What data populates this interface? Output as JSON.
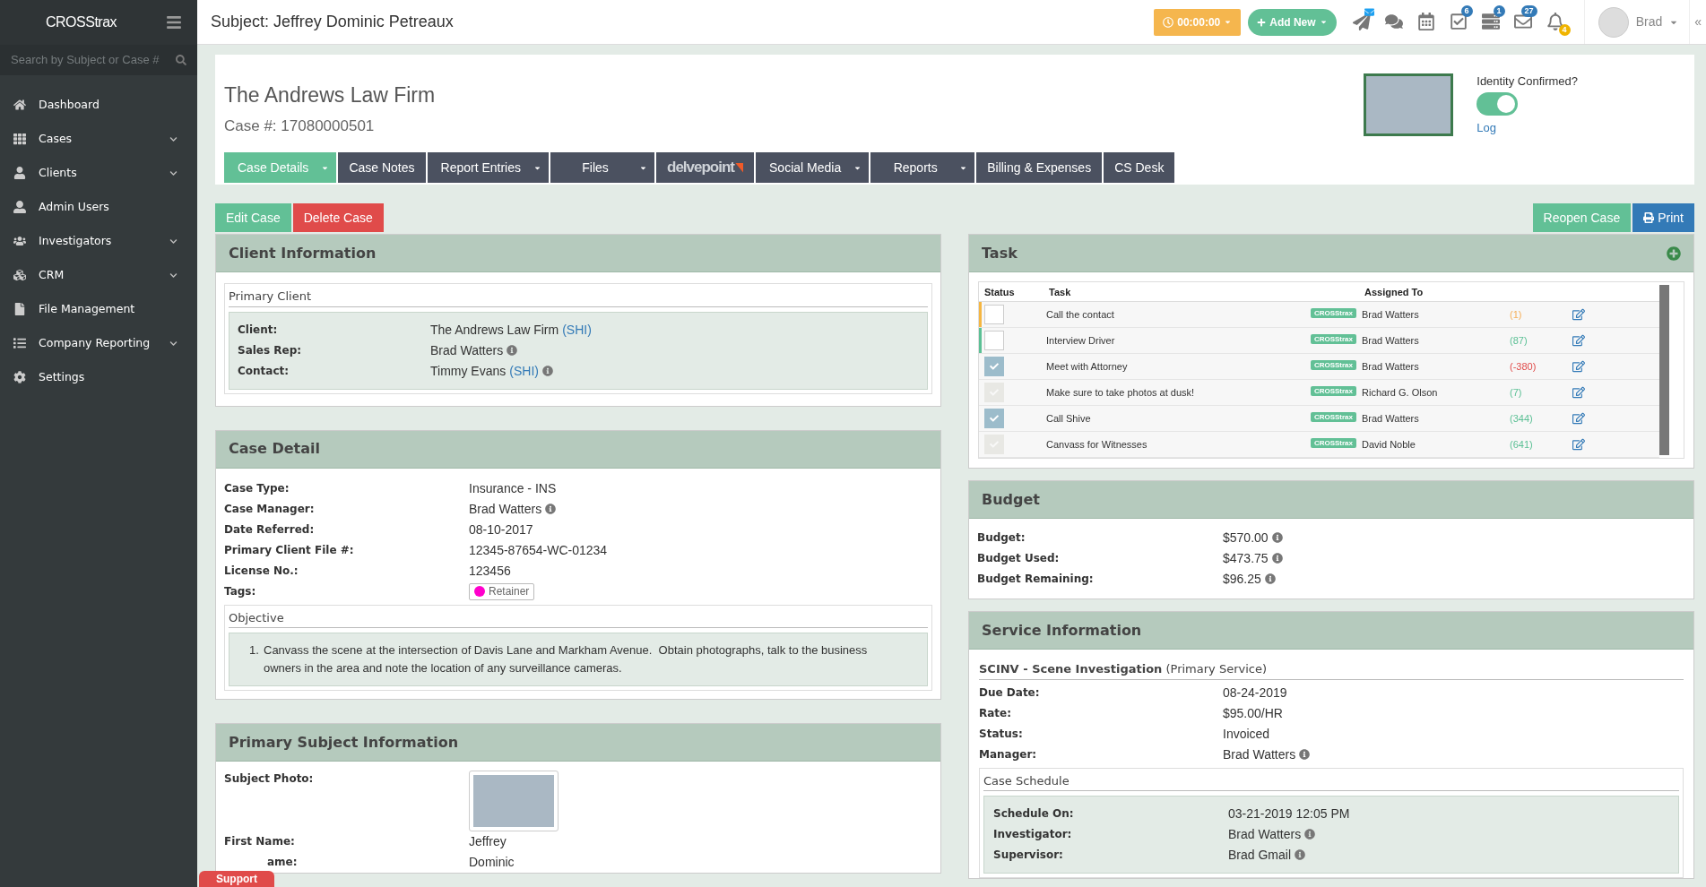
{
  "sidebar": {
    "brand": "CROSStrax",
    "search": {
      "placeholder": "Search by Subject or Case #"
    },
    "items": [
      {
        "label": "Dashboard",
        "submenu": false
      },
      {
        "label": "Cases",
        "submenu": true
      },
      {
        "label": "Clients",
        "submenu": true
      },
      {
        "label": "Admin Users",
        "submenu": false
      },
      {
        "label": "Investigators",
        "submenu": true
      },
      {
        "label": "CRM",
        "submenu": true
      },
      {
        "label": "File Management",
        "submenu": false
      },
      {
        "label": "Company Reporting",
        "submenu": true
      },
      {
        "label": "Settings",
        "submenu": false
      }
    ],
    "support": "Support"
  },
  "topbar": {
    "title": "Subject: Jeffrey Dominic Petreaux",
    "timer": "00:00:00",
    "add_new": "Add New",
    "badges": [
      {
        "badge": "6",
        "kind": "info"
      },
      {
        "badge": "1",
        "kind": "info"
      },
      {
        "badge": "27",
        "kind": "info"
      },
      {
        "badge": "4",
        "kind": "warning"
      }
    ],
    "user": "Brad",
    "collapse": "«"
  },
  "header": {
    "firm": "The Andrews Law Firm",
    "case_no": "Case #: 17080000501",
    "identity": {
      "label": "Identity Confirmed?",
      "on": true,
      "link": "Log"
    }
  },
  "tabs": [
    {
      "label": "Case Details",
      "selected": true,
      "menu": true,
      "kind": "text"
    },
    {
      "label": "Case Notes",
      "selected": false,
      "menu": false,
      "kind": "text"
    },
    {
      "label": "Report Entries",
      "selected": false,
      "menu": true,
      "kind": "text"
    },
    {
      "label": "Files",
      "selected": false,
      "menu": true,
      "kind": "text"
    },
    {
      "label": "delvepoint",
      "selected": false,
      "menu": false,
      "kind": "logo"
    },
    {
      "label": "Social Media",
      "selected": false,
      "menu": true,
      "kind": "text"
    },
    {
      "label": "Reports",
      "selected": false,
      "menu": true,
      "kind": "text"
    },
    {
      "label": "Billing & Expenses",
      "selected": false,
      "menu": false,
      "kind": "text"
    },
    {
      "label": "CS Desk",
      "selected": false,
      "menu": false,
      "kind": "text"
    }
  ],
  "actions": {
    "left": [
      {
        "label": "Edit Case",
        "kind": "success"
      },
      {
        "label": "Delete Case",
        "kind": "danger"
      }
    ],
    "right": [
      {
        "label": "Reopen Case",
        "kind": "success"
      },
      {
        "label": "Print",
        "kind": "print"
      }
    ]
  },
  "client_information": {
    "title": "Client Information",
    "legend": "Primary Client",
    "rows": [
      {
        "label": "Client:",
        "value": "The Andrews Law Firm",
        "link": "(SHI)",
        "info": false
      },
      {
        "label": "Sales Rep:",
        "value": "Brad Watters",
        "info": true
      },
      {
        "label": "Contact:",
        "value": "Timmy Evans",
        "link": "(SHI)",
        "info": true
      }
    ]
  },
  "case_detail": {
    "title": "Case Detail",
    "rows": [
      {
        "label": "Case Type:",
        "value": "Insurance - INS",
        "info": false
      },
      {
        "label": "Case Manager:",
        "value": "Brad Watters",
        "info": true
      },
      {
        "label": "Date Referred:",
        "value": "08-10-2017",
        "info": false
      },
      {
        "label": "Primary Client File #:",
        "value": "12345-87654-WC-01234",
        "info": false
      },
      {
        "label": "License No.:",
        "value": "123456",
        "info": false
      }
    ],
    "tags_label": "Tags:",
    "tags": [
      {
        "label": "Retainer",
        "color": "#ff00cc"
      }
    ],
    "objective": {
      "legend": "Objective",
      "items": [
        {
          "number": "1.",
          "text": "Canvass the scene at the intersection of Davis Lane and Markham Avenue.  Obtain photographs, talk to the business owners in the area and note the location of any surveillance cameras."
        }
      ]
    }
  },
  "primary_subject": {
    "title": "Primary Subject Information",
    "photo_label": "Subject Photo:",
    "rows": [
      {
        "label": "First Name:",
        "value": "Jeffrey"
      },
      {
        "label": "ame:",
        "value": "Dominic"
      }
    ]
  },
  "task": {
    "title": "Task",
    "columns": [
      "Status",
      "Task",
      "Assigned To"
    ],
    "rows": [
      {
        "task": "Call the contact",
        "source": "CROSStrax",
        "assignee": "Brad Watters",
        "count": "(1)",
        "kind": "warning",
        "checked": false,
        "disabled": false,
        "color": "#f5b642"
      },
      {
        "task": "Interview Driver",
        "source": "CROSStrax",
        "assignee": "Brad Watters",
        "count": "(87)",
        "kind": "ok",
        "checked": false,
        "disabled": false,
        "color": "#5cc095"
      },
      {
        "task": "Meet with Attorney",
        "source": "CROSStrax",
        "assignee": "Brad Watters",
        "count": "(-380)",
        "kind": "overdue",
        "checked": true,
        "disabled": false
      },
      {
        "task": "Make sure to take photos at dusk!",
        "source": "CROSStrax",
        "assignee": "Richard G. Olson",
        "count": "(7)",
        "kind": "ok",
        "checked": true,
        "disabled": true
      },
      {
        "task": "Call Shive",
        "source": "CROSStrax",
        "assignee": "Brad Watters",
        "count": "(344)",
        "kind": "ok",
        "checked": true,
        "disabled": false
      },
      {
        "task": "Canvass for Witnesses",
        "source": "CROSStrax",
        "assignee": "David Noble",
        "count": "(641)",
        "kind": "ok",
        "checked": true,
        "disabled": true
      }
    ]
  },
  "budget": {
    "title": "Budget",
    "rows": [
      {
        "label": "Budget:",
        "value": "$570.00",
        "info": true
      },
      {
        "label": "Budget Used:",
        "value": "$473.75",
        "info": true
      },
      {
        "label": "Budget Remaining:",
        "value": "$96.25",
        "info": true
      }
    ]
  },
  "service": {
    "title": "Service Information",
    "name": "SCINV - Scene Investigation",
    "note": "(Primary Service)",
    "rows": [
      {
        "label": "Due Date:",
        "value": "08-24-2019",
        "info": false
      },
      {
        "label": "Rate:",
        "value": "$95.00/HR",
        "info": false
      },
      {
        "label": "Status:",
        "value": "Invoiced",
        "info": false
      },
      {
        "label": "Manager:",
        "value": "Brad Watters",
        "info": true
      }
    ],
    "schedule": {
      "legend": "Case Schedule",
      "rows": [
        {
          "label": "Schedule On:",
          "value": "03-21-2019 12:05 PM",
          "info": false
        },
        {
          "label": "Investigator:",
          "value": "Brad Watters",
          "info": true
        },
        {
          "label": "Supervisor:",
          "value": "Brad Gmail",
          "info": true
        }
      ]
    }
  }
}
